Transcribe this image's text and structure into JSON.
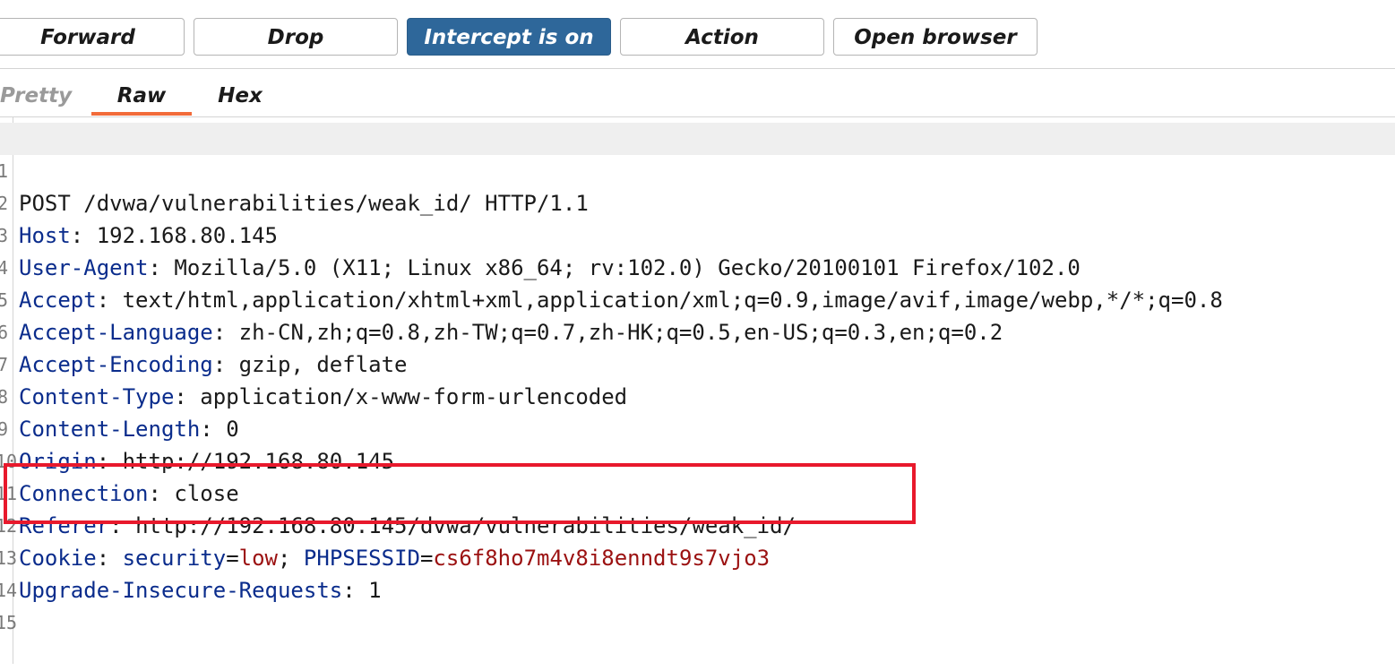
{
  "toolbar": {
    "forward_label": "Forward",
    "drop_label": "Drop",
    "intercept_label": "Intercept is on",
    "action_label": "Action",
    "open_browser_label": "Open browser"
  },
  "tabs": [
    {
      "label": "Pretty",
      "active": false
    },
    {
      "label": "Raw",
      "active": true
    },
    {
      "label": "Hex",
      "active": false
    }
  ],
  "request_lines": [
    {
      "num": "1",
      "text": "POST /dvwa/vulnerabilities/weak_id/ HTTP/1.1"
    },
    {
      "num": "2",
      "name": "Host",
      "value": "192.168.80.145"
    },
    {
      "num": "3",
      "name": "User-Agent",
      "value": "Mozilla/5.0 (X11; Linux x86_64; rv:102.0) Gecko/20100101 Firefox/102.0"
    },
    {
      "num": "4",
      "name": "Accept",
      "value": "text/html,application/xhtml+xml,application/xml;q=0.9,image/avif,image/webp,*/*;q=0.8"
    },
    {
      "num": "5",
      "name": "Accept-Language",
      "value": "zh-CN,zh;q=0.8,zh-TW;q=0.7,zh-HK;q=0.5,en-US;q=0.3,en;q=0.2"
    },
    {
      "num": "6",
      "name": "Accept-Encoding",
      "value": "gzip, deflate"
    },
    {
      "num": "7",
      "name": "Content-Type",
      "value": "application/x-www-form-urlencoded"
    },
    {
      "num": "8",
      "name": "Content-Length",
      "value": "0"
    },
    {
      "num": "9",
      "name": "Origin",
      "value": "http://192.168.80.145"
    },
    {
      "num": "10",
      "name": "Connection",
      "value": "close"
    },
    {
      "num": "11",
      "name": "Referer",
      "value": "http://192.168.80.145/dvwa/vulnerabilities/weak_id/"
    },
    {
      "num": "12",
      "name": "Cookie",
      "cookie_name_1": "security",
      "cookie_value_1": "low",
      "cookie_name_2": "PHPSESSID",
      "cookie_value_2": "cs6f8ho7m4v8i8enndt9s7vjo3"
    },
    {
      "num": "13",
      "name": "Upgrade-Insecure-Requests",
      "value": "1"
    },
    {
      "num": "14"
    },
    {
      "num": "15"
    }
  ],
  "colors": {
    "intercept_on_bg": "#2e679a",
    "tab_underline": "#f26b3a",
    "header_name": "#0a2c8c",
    "cookie_value": "#9b1111",
    "annotation_box": "#e8192c"
  }
}
